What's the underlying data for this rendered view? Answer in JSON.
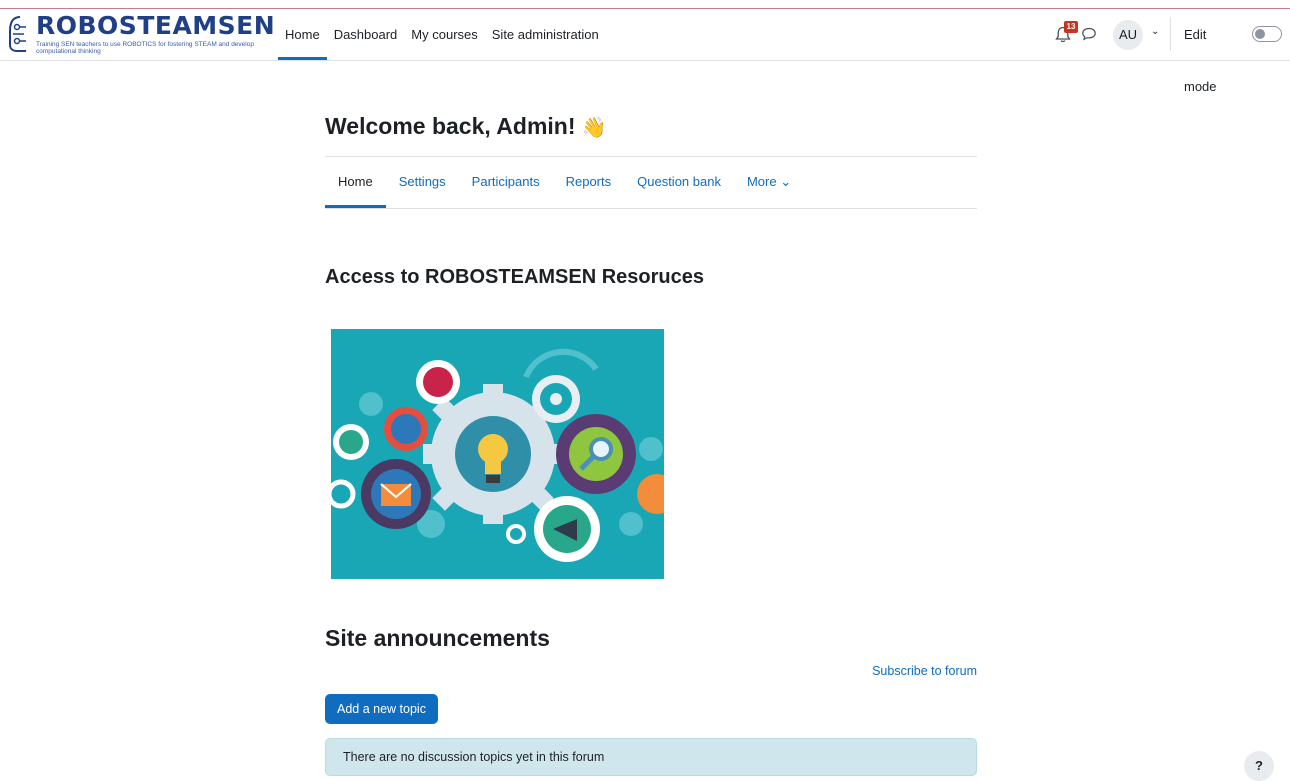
{
  "brand": {
    "title": "ROBOSTEAMSEN",
    "subtitle": "Training SEN teachers to use ROBOTICS for fostering STEAM and develop computational thinking",
    "color": "#1f3f86"
  },
  "primary_nav": {
    "items": [
      {
        "label": "Home",
        "active": true
      },
      {
        "label": "Dashboard",
        "active": false
      },
      {
        "label": "My courses",
        "active": false
      },
      {
        "label": "Site administration",
        "active": false
      }
    ]
  },
  "user_menu": {
    "notification_count": "13",
    "avatar_initials": "AU",
    "edit_mode_label": "Edit mode",
    "edit_mode_on": false
  },
  "page": {
    "title": "Welcome back, Admin!",
    "title_emoji": "👋"
  },
  "secondary_nav": {
    "tabs": [
      {
        "label": "Home",
        "active": true
      },
      {
        "label": "Settings",
        "active": false
      },
      {
        "label": "Participants",
        "active": false
      },
      {
        "label": "Reports",
        "active": false
      },
      {
        "label": "Question bank",
        "active": false
      },
      {
        "label": "More ⌄",
        "active": false
      }
    ]
  },
  "resources": {
    "heading": "Access to ROBOSTEAMSEN Resoruces",
    "image_background": "#1aa7b5"
  },
  "announcements": {
    "heading": "Site announcements",
    "subscribe_label": "Subscribe to forum",
    "add_topic_label": "Add a new topic",
    "empty_message": "There are no discussion topics yet in this forum"
  },
  "help": {
    "label": "?"
  },
  "colors": {
    "accent": "#0f6cbf",
    "badge": "#ca3120",
    "info_bg": "#cfe7ec"
  }
}
